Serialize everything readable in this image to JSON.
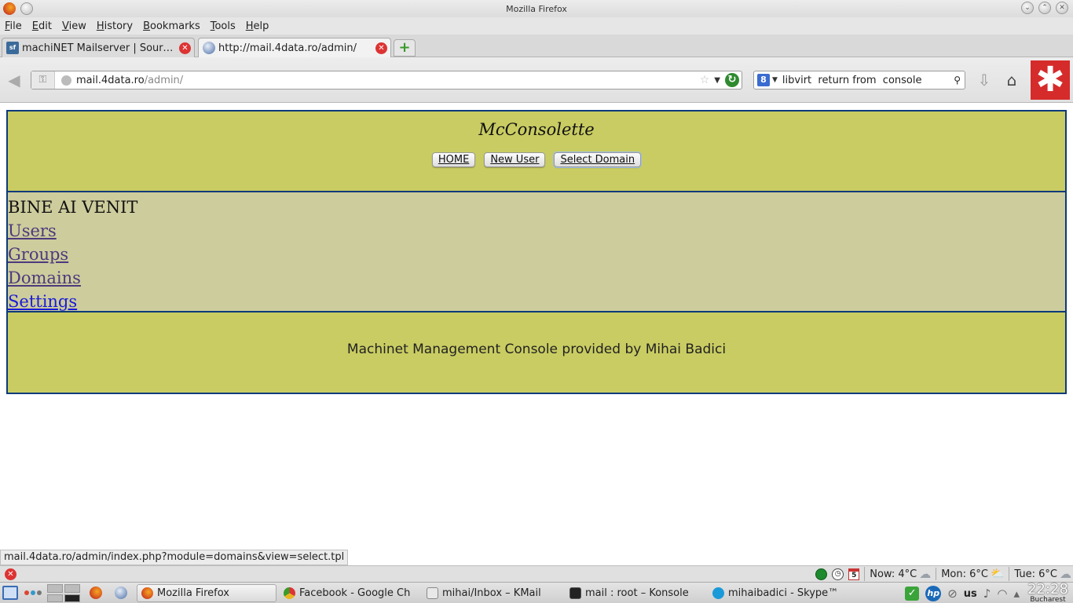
{
  "window": {
    "title": "Mozilla Firefox"
  },
  "menu": [
    "File",
    "Edit",
    "View",
    "History",
    "Bookmarks",
    "Tools",
    "Help"
  ],
  "tabs": [
    {
      "label": "machiNET Mailserver | Sourc...",
      "favicon": "sf"
    },
    {
      "label": "http://mail.4data.ro/admin/",
      "favicon": "globe"
    }
  ],
  "url": {
    "host": "mail.4data.ro",
    "path": "/admin/"
  },
  "search": {
    "engine_icon": "8",
    "value": "libvirt  return from  console"
  },
  "page": {
    "title": "McConsolette",
    "buttons": [
      "HOME",
      "New User",
      "Select Domain"
    ],
    "welcome": "BINE AI VENIT",
    "links": [
      "Users",
      "Groups",
      "Domains",
      "Settings"
    ],
    "footer": "Machinet Management Console provided by Mihai Badici"
  },
  "status_link": "mail.4data.ro/admin/index.php?module=domains&view=select.tpl",
  "statusbar": {
    "calendar_day": "5",
    "weather": [
      {
        "label": "Now: 4°C",
        "icon": "cloud"
      },
      {
        "label": "Mon: 6°C",
        "icon": "sun-cloud"
      },
      {
        "label": "Tue: 6°C",
        "icon": "cloud"
      }
    ]
  },
  "taskbar": {
    "tasks": [
      {
        "label": "Mozilla Firefox",
        "color": "#d0431c"
      },
      {
        "label": "Facebook - Google Chr",
        "color": "#e8b520"
      },
      {
        "label": "mihai/Inbox – KMail",
        "color": "#888888"
      },
      {
        "label": "mail : root – Konsole",
        "color": "#222222"
      },
      {
        "label": "mihaibadici - Skype™",
        "color": "#1a9ad8"
      }
    ],
    "layout": "us",
    "time": "22:28",
    "city": "Bucharest"
  }
}
